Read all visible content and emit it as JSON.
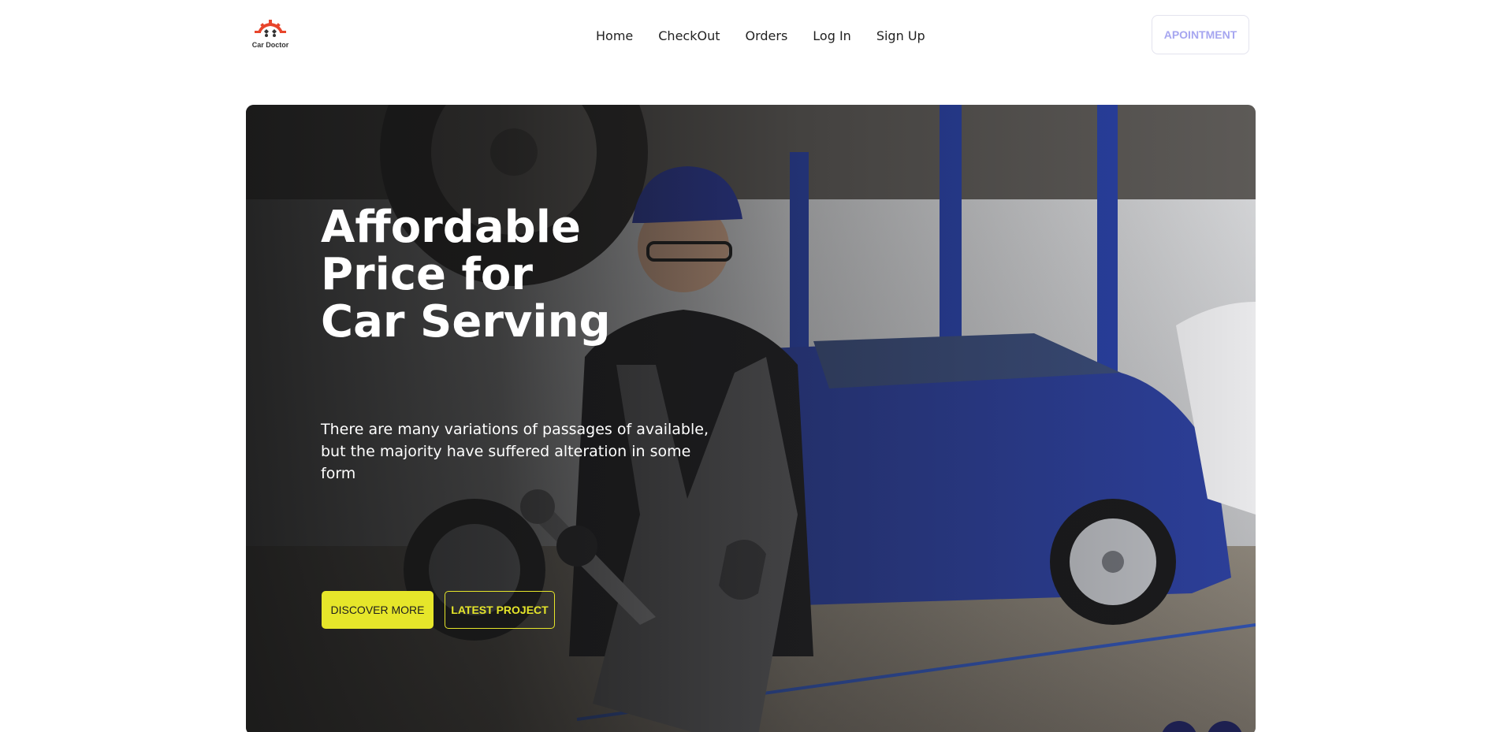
{
  "header": {
    "logo_text": "Car Doctor",
    "nav": [
      "Home",
      "CheckOut",
      "Orders",
      "Log In",
      "Sign Up"
    ],
    "appointment_label": "APOINTMENT"
  },
  "hero": {
    "title_lines": [
      "Affordable",
      "Price for",
      "Car Serving"
    ],
    "description": "There are many variations of passages of available, but the majority have suffered alteration in some form",
    "discover_label": "DISCOVER MORE",
    "latest_label": "LATEST PROJECT"
  },
  "colors": {
    "accent": "#e6e62a",
    "logo_red": "#e8452c",
    "appointment_text": "#a6a6f0",
    "slide_button": "#1d2050"
  },
  "icons": [
    "car-doctor-logo-icon"
  ]
}
